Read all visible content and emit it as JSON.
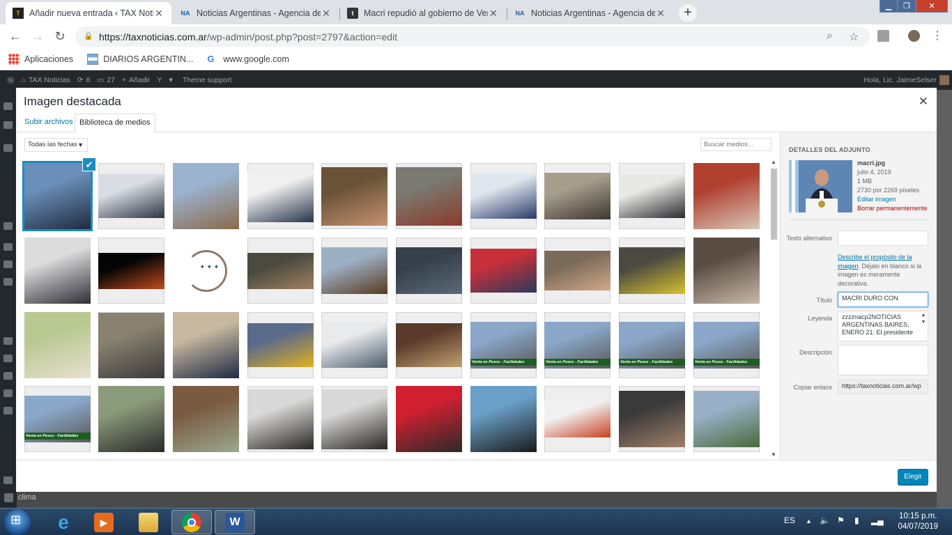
{
  "browser": {
    "tabs": [
      {
        "title": "Añadir nueva entrada ‹ TAX Noticias",
        "icon": "tax-favicon-icon",
        "active": true
      },
      {
        "title": "Noticias Argentinas - Agencia de",
        "icon": "na-favicon-icon",
        "active": false
      },
      {
        "title": "Macri repudió al gobierno de Venezuela",
        "icon": "t-favicon-icon",
        "active": false
      },
      {
        "title": "Noticias Argentinas - Agencia de",
        "icon": "na-favicon-icon",
        "active": false
      }
    ],
    "new_tab": "+",
    "url_host": "https://taxnoticias.com.ar",
    "url_path": "/wp-admin/post.php?post=2797&action=edit",
    "bookmarks": [
      {
        "label": "Aplicaciones",
        "icon": "apps-grid-icon"
      },
      {
        "label": "DIARIOS ARGENTIN...",
        "icon": "argentina-flag-icon"
      },
      {
        "label": "www.google.com",
        "icon": "google-icon"
      }
    ]
  },
  "adminbar": {
    "site": "TAX Noticias",
    "updates": "6",
    "comments": "27",
    "new": "Añadir",
    "support": "Theme support",
    "greeting": "Hola, Lic. JaimeSelser"
  },
  "modal": {
    "title": "Imagen destacada",
    "tab_upload": "Subir archivos",
    "tab_library": "Biblioteca de medios",
    "date_filter": "Todas las fechas",
    "search_placeholder": "Buscar medios...",
    "choose_button": "Elegir"
  },
  "attachment": {
    "heading": "DETALLES DEL ADJUNTO",
    "filename": "macri.jpg",
    "date": "julio 4, 2019",
    "size": "1 MB",
    "dimensions": "2730 por 2269 píxeles",
    "edit_link": "Editar imagen",
    "delete_link": "Borrar permanentemente",
    "alt_label": "Texto alternativo",
    "alt_value": "",
    "alt_hint_link": "Describe el propósito de la imagen",
    "alt_hint_rest": ". Déjalo en blanco si la imagen es meramente decorativa.",
    "title_label": "Título",
    "title_value": "MACRI DURO CON",
    "caption_label": "Leyenda",
    "caption_value": "zzzznacp2NOTICIAS ARGENTINAS BAIRES, ENERO 21: El presidente",
    "description_label": "Descripción",
    "description_value": "",
    "copy_label": "Copiar enlace",
    "copy_value": "https://taxnoticias.com.ar/wp"
  },
  "background": {
    "clima": "clima"
  },
  "taskbar": {
    "lang": "ES",
    "time": "10:15 p.m.",
    "date": "04/07/2019"
  },
  "media_items": [
    {
      "name": "media-macri-podium",
      "c1": "#6a8fb8",
      "c2": "#1e2a3e",
      "h": 1.0,
      "selected": true
    },
    {
      "name": "media-press-table",
      "c1": "#d8dde4",
      "c2": "#2c3440",
      "h": 0.66
    },
    {
      "name": "media-surveyor-field",
      "c1": "#9bb3cf",
      "c2": "#8a6a4a",
      "h": 1.0
    },
    {
      "name": "media-fbi-agents",
      "c1": "#f0f0f0",
      "c2": "#27344a",
      "h": 0.78
    },
    {
      "name": "media-man-portrait",
      "c1": "#6a5236",
      "c2": "#c49270",
      "h": 0.88
    },
    {
      "name": "media-car-factory",
      "c1": "#7a7a72",
      "c2": "#8c3a2a",
      "h": 0.88
    },
    {
      "name": "media-todos-conference",
      "c1": "#dfe6ee",
      "c2": "#2a3a6a",
      "h": 0.68
    },
    {
      "name": "media-meeting-room",
      "c1": "#a79d8c",
      "c2": "#3b3630",
      "h": 0.71
    },
    {
      "name": "media-white-room-meeting",
      "c1": "#e8e8e6",
      "c2": "#2a2a2e",
      "h": 0.66
    },
    {
      "name": "media-elderly-men-flags",
      "c1": "#b04030",
      "c2": "#d8c8b8",
      "h": 1.0
    },
    {
      "name": "media-two-men-portrait",
      "c1": "#dcdcdc",
      "c2": "#2e2e36",
      "h": 1.0
    },
    {
      "name": "media-blood-moon",
      "c1": "#050505",
      "c2": "#c24a1e",
      "h": 0.55
    },
    {
      "name": "media-parlamento-mercosur",
      "c1": "#ffffff",
      "c2": "#1d3f7a",
      "h": 1.0,
      "logo": true
    },
    {
      "name": "media-bald-man",
      "c1": "#4a4a3e",
      "c2": "#a08060",
      "h": 0.55
    },
    {
      "name": "media-rusty-machinery",
      "c1": "#9cb0c4",
      "c2": "#5a3a22",
      "h": 0.7
    },
    {
      "name": "media-hooded-protester",
      "c1": "#36404a",
      "c2": "#5a6a78",
      "h": 0.7
    },
    {
      "name": "media-trump-xi",
      "c1": "#c8303a",
      "c2": "#2a3a5a",
      "h": 0.66
    },
    {
      "name": "media-older-man-chair",
      "c1": "#7a6a5a",
      "c2": "#d2a888",
      "h": 0.6
    },
    {
      "name": "media-taxis-street",
      "c1": "#4a4a40",
      "c2": "#d8c030",
      "h": 0.7
    },
    {
      "name": "media-man-microphones",
      "c1": "#5a4e44",
      "c2": "#c8b8a8",
      "h": 1.0
    },
    {
      "name": "media-child-drawing",
      "c1": "#b8c890",
      "c2": "#e8e0d0",
      "h": 1.0
    },
    {
      "name": "media-bank-building",
      "c1": "#8a8270",
      "c2": "#3a3a3a",
      "h": 0.99
    },
    {
      "name": "media-macri-abe",
      "c1": "#c8b8a0",
      "c2": "#1e2a44",
      "h": 1.0
    },
    {
      "name": "media-train-crash",
      "c1": "#5a6a8a",
      "c2": "#e0b020",
      "h": 0.66
    },
    {
      "name": "media-press-panel",
      "c1": "#e8eaec",
      "c2": "#4a5a6a",
      "h": 0.68
    },
    {
      "name": "media-congress-session",
      "c1": "#5a3a2a",
      "c2": "#c0a070",
      "h": 0.66
    },
    {
      "name": "media-building-pesos-1",
      "c1": "#8aa6c8",
      "c2": "#5a5a58",
      "h": 0.7,
      "banner": "Venta en Pesos - Facilidades"
    },
    {
      "name": "media-building-pesos-2",
      "c1": "#8aa6c8",
      "c2": "#5a5a58",
      "h": 0.7,
      "banner": "Venta en Pesos - Facilidades"
    },
    {
      "name": "media-building-pesos-3",
      "c1": "#8aa6c8",
      "c2": "#5a5a58",
      "h": 0.7,
      "banner": "Venta en Pesos - Facilidades"
    },
    {
      "name": "media-building-pesos-4",
      "c1": "#8aa6c8",
      "c2": "#5a5a58",
      "h": 0.7,
      "banner": "Venta en Pesos - Facilidades"
    },
    {
      "name": "media-building-pesos-5",
      "c1": "#8aa6c8",
      "c2": "#5a5a58",
      "h": 0.7,
      "banner": "Venta en Pesos - Facilidades"
    },
    {
      "name": "media-man-voting",
      "c1": "#8a9a7a",
      "c2": "#2a2a2a",
      "h": 1.0
    },
    {
      "name": "media-gavel-dollars",
      "c1": "#7a5a40",
      "c2": "#9aa890",
      "h": 1.0
    },
    {
      "name": "media-young-man-1",
      "c1": "#d8d8d8",
      "c2": "#2a2622",
      "h": 0.9
    },
    {
      "name": "media-young-man-2",
      "c1": "#d8d8d8",
      "c2": "#2a2622",
      "h": 0.9
    },
    {
      "name": "media-debate-capital",
      "c1": "#d02030",
      "c2": "#2a2a2a",
      "h": 1.0
    },
    {
      "name": "media-woman-mic",
      "c1": "#6aa0c8",
      "c2": "#1a1a1a",
      "h": 1.0
    },
    {
      "name": "media-argentina-woman",
      "c1": "#f0f0f0",
      "c2": "#c84020",
      "h": 0.55
    },
    {
      "name": "media-men-conversation",
      "c1": "#3a3a3a",
      "c2": "#a08068",
      "h": 0.85
    },
    {
      "name": "media-people-walking",
      "c1": "#9ab0c8",
      "c2": "#4a6a3a",
      "h": 0.85
    }
  ]
}
